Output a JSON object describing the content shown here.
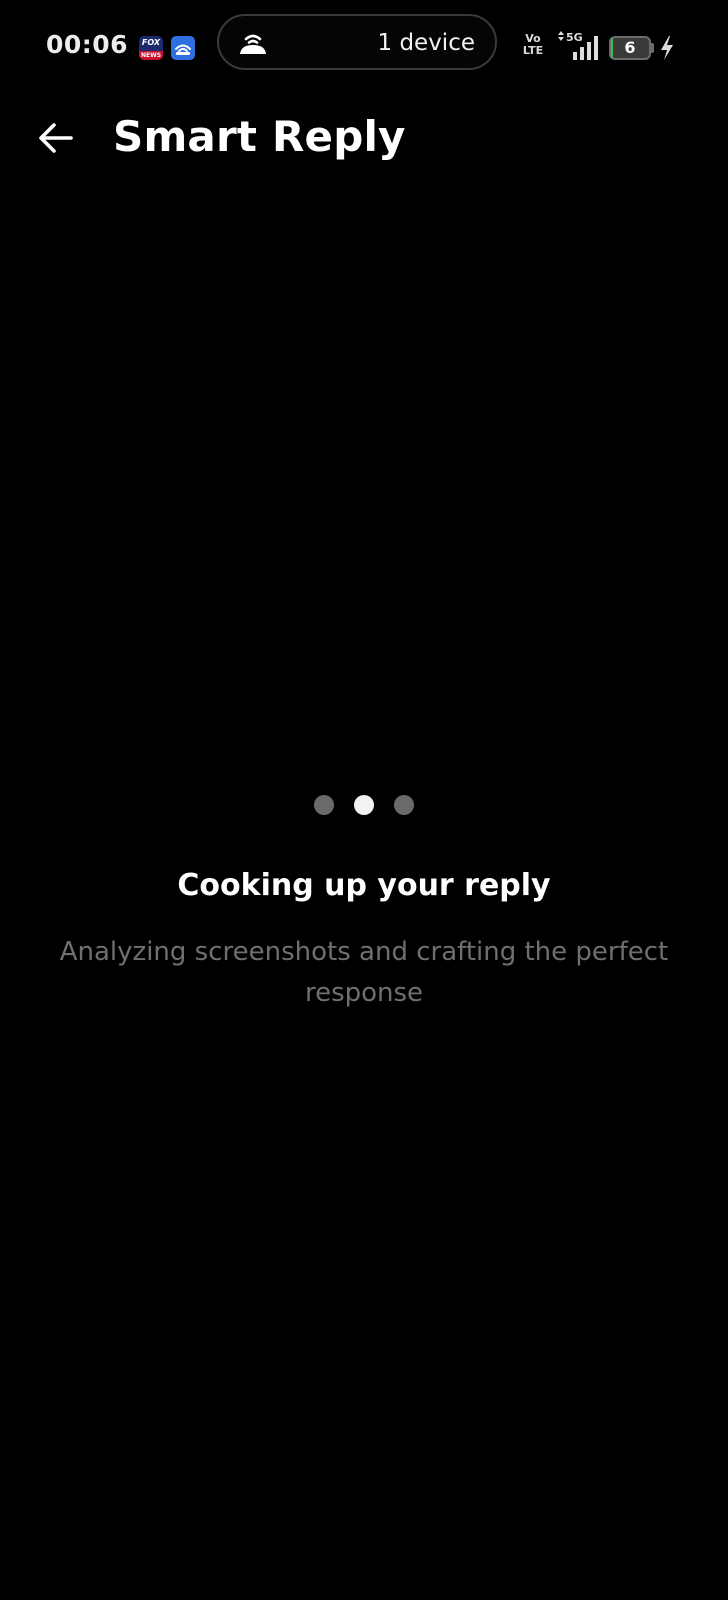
{
  "status_bar": {
    "time": "00:06",
    "fox_icon_text_top": "FOX",
    "fox_icon_text_bottom": "NEWS",
    "hotspot_text": "1 device",
    "network_volte_top": "Vo",
    "network_volte_bottom": "LTE",
    "network_type": "5G",
    "battery_level": "6",
    "battery_fraction": 0.06,
    "icons": [
      "fox-news-icon",
      "hotspot-app-icon",
      "hotspot-icon",
      "volte-icon",
      "signal-5g-icon",
      "battery-icon",
      "charging-icon"
    ]
  },
  "app_bar": {
    "title": "Smart Reply",
    "back_icon": "arrow-left-icon"
  },
  "loading": {
    "dots": [
      {
        "state": "inactive",
        "color": "#6a6a6a"
      },
      {
        "state": "active",
        "color": "#f2f2f2"
      },
      {
        "state": "inactive",
        "color": "#6a6a6a"
      }
    ],
    "title": "Cooking up your reply",
    "subtitle": "Analyzing screenshots and crafting the perfect response"
  },
  "colors": {
    "background": "#000000",
    "text_primary": "#ffffff",
    "text_secondary": "#6f6f6f",
    "battery_green": "#3fbf4f",
    "hotspot_blue": "#2f6fe0"
  }
}
